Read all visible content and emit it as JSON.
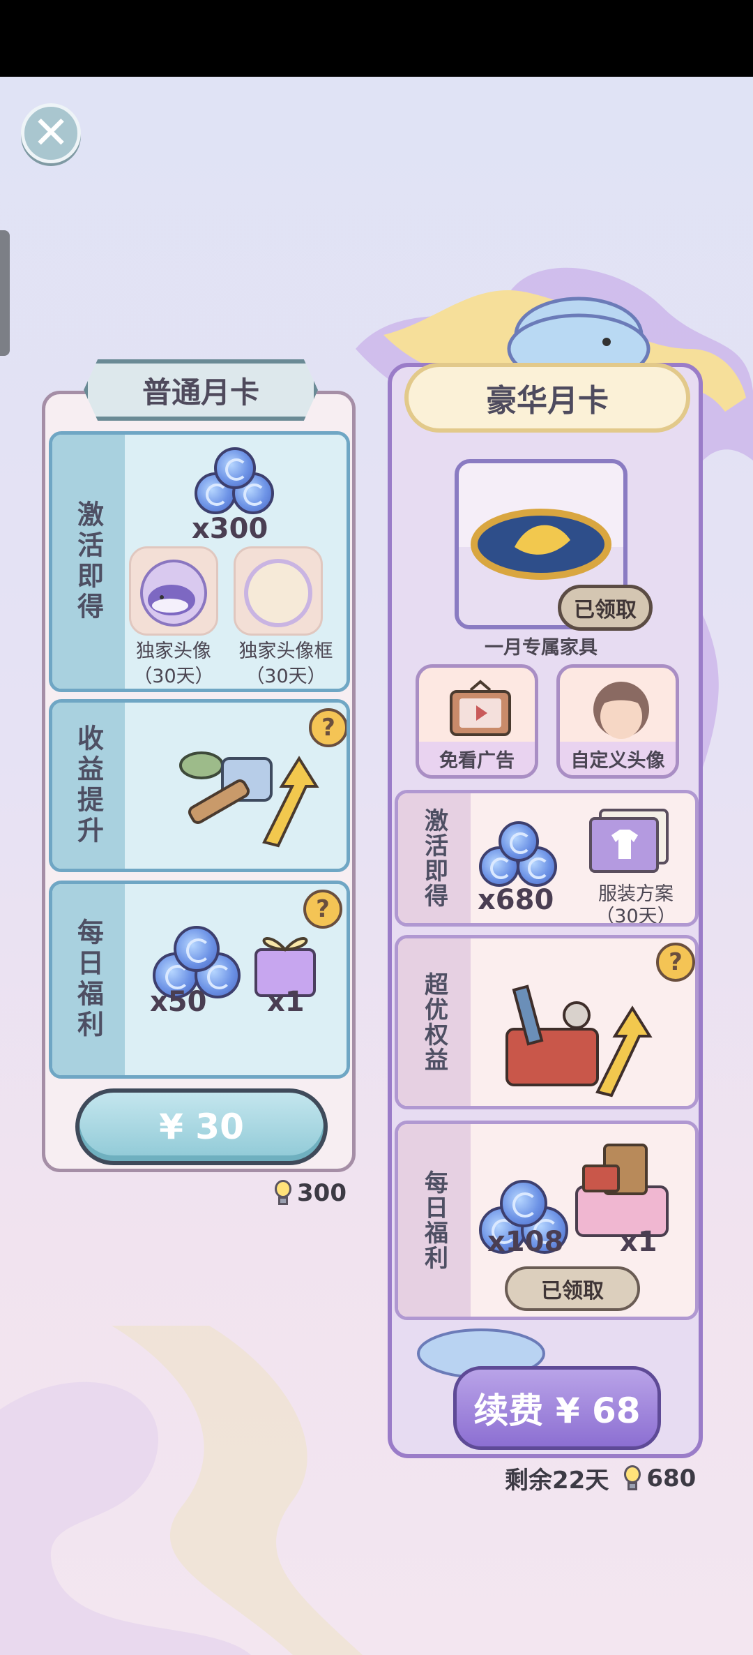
{
  "top_bar": {
    "close_icon": "close-x-icon"
  },
  "normal_card": {
    "title": "普通月卡",
    "activate": {
      "label": "激活即得",
      "gem_qty": "x300",
      "avatar_label_1": "独家头像",
      "avatar_days_1": "（30天）",
      "avatar_label_2": "独家头像框",
      "avatar_days_2": "（30天）"
    },
    "income": {
      "label": "收益提升",
      "help": "?"
    },
    "daily": {
      "label": "每日福利",
      "help": "?",
      "gem_qty": "x50",
      "gift_qty": "x1"
    },
    "buy_button": "¥ 30",
    "bulb_reward": "300"
  },
  "deluxe_card": {
    "title": "豪华月卡",
    "furniture_caption": "一月专属家具",
    "furniture_status": "已领取",
    "perk_1": "免看广告",
    "perk_2": "自定义头像",
    "activate": {
      "label": "激活即得",
      "gem_qty": "x680",
      "outfit_label": "服装方案",
      "outfit_days": "（30天）"
    },
    "super": {
      "label": "超优权益",
      "help": "?"
    },
    "daily": {
      "label": "每日福利",
      "gem_qty": "x108",
      "gift_qty": "x1",
      "status": "已领取"
    },
    "renew_button": "续费 ¥ 68",
    "remaining": "剩余22天",
    "bulb_reward": "680"
  },
  "colors": {
    "normal_accent": "#6fa6c4",
    "deluxe_accent": "#9a7cc8",
    "gold": "#f4c455"
  }
}
